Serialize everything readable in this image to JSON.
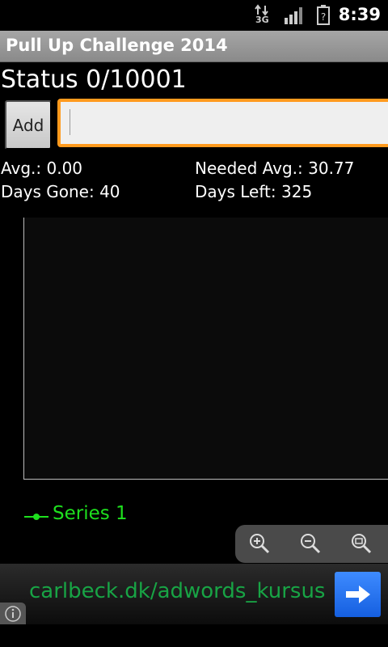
{
  "status_bar": {
    "time": "8:39",
    "network_label": "3G",
    "icons": [
      "data-arrows-icon",
      "signal-bars-icon",
      "battery-unknown-icon"
    ]
  },
  "app": {
    "title": "Pull Up Challenge 2014"
  },
  "progress": {
    "status_text": "Status 0/10001"
  },
  "entry": {
    "add_label": "Add",
    "input_value": "",
    "input_placeholder": ""
  },
  "stats": {
    "avg": "Avg.: 0.00",
    "needed_avg": "Needed Avg.: 30.77",
    "days_gone": "Days Gone: 40",
    "days_left": "Days Left: 325"
  },
  "chart": {
    "legend_series": "Series 1",
    "series_color": "#1ee01e",
    "zoom_icons": [
      "zoom-in-icon",
      "zoom-out-icon",
      "zoom-reset-icon"
    ]
  },
  "ad": {
    "text": "carlbeck.dk/adwords_kursus",
    "text_color": "#18a445",
    "button_icon": "arrow-right-icon",
    "info_icon": "info-icon"
  },
  "colors": {
    "input_focus_border": "#ff9a1e",
    "ad_button": "#2a75f0"
  }
}
